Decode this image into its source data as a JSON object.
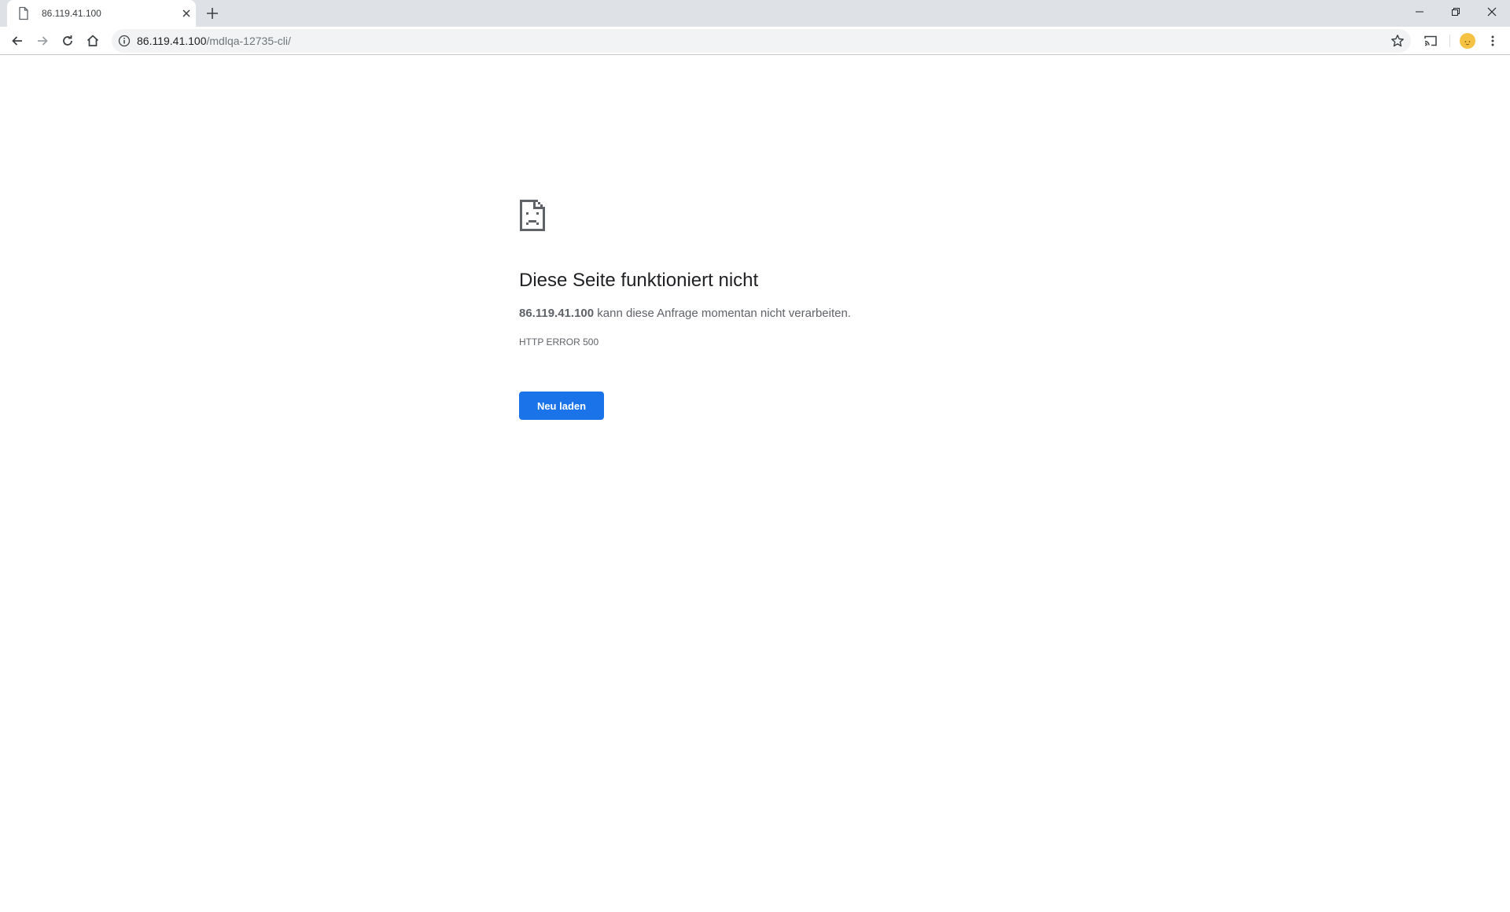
{
  "browser": {
    "tab": {
      "title": "86.119.41.100",
      "favicon": "page-icon"
    },
    "omnibox": {
      "host": "86.119.41.100",
      "path": "/mdlqa-12735-cli/"
    },
    "icons": {
      "back": "arrow-left-icon",
      "forward": "arrow-right-icon",
      "reload": "reload-icon",
      "home": "home-icon",
      "info": "info-icon",
      "bookmark": "star-icon",
      "cast": "cast-icon",
      "menu": "more-vertical-icon"
    },
    "colors": {
      "tabstrip": "#dee1e6",
      "omnibox": "#f1f3f4",
      "avatar": "#f6c244"
    }
  },
  "error": {
    "icon": "sad-page-icon",
    "title": "Diese Seite funktioniert nicht",
    "host": "86.119.41.100",
    "description": "kann diese Anfrage momentan nicht verarbeiten.",
    "code": "HTTP ERROR 500",
    "reload_label": "Neu laden",
    "colors": {
      "button": "#1a73e8",
      "title": "#202124",
      "text": "#5f6368"
    }
  }
}
